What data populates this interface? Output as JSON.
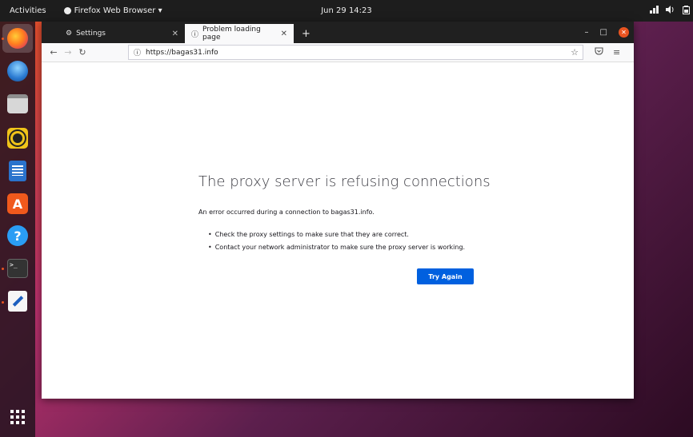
{
  "topbar": {
    "activities": "Activities",
    "app_menu": "Firefox Web Browser ▾",
    "clock": "Jun 29 14:23",
    "tray": [
      "network-icon",
      "volume-icon",
      "battery-icon"
    ]
  },
  "dock": {
    "items": [
      "firefox",
      "thunderbird",
      "files",
      "rhythmbox",
      "libreoffice-writer",
      "software",
      "help",
      "terminal",
      "text-editor"
    ],
    "apps_grid": "show-applications"
  },
  "browser": {
    "tabs": [
      {
        "label": "Settings",
        "icon": "gear-icon",
        "active": false
      },
      {
        "label": "Problem loading page",
        "icon": "info-icon",
        "active": true
      }
    ],
    "new_tab": "+",
    "url": "https://bagas31.info",
    "window_controls": {
      "minimize": "–",
      "maximize": "□",
      "close": "✕"
    }
  },
  "error_page": {
    "title": "The proxy server is refusing connections",
    "description": "An error occurred during a connection to bagas31.info.",
    "bullets": [
      "Check the proxy settings to make sure that they are correct.",
      "Contact your network administrator to make sure the proxy server is working."
    ],
    "button": "Try Again"
  },
  "colors": {
    "accent": "#0060df",
    "ubuntu_orange": "#e95420",
    "topbar": "#1d1d1d",
    "tabbar": "#202020"
  }
}
